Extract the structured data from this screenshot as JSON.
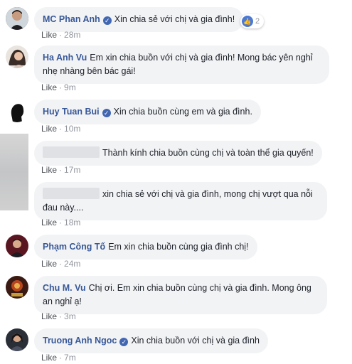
{
  "comments": [
    {
      "author": "MC Phan Anh",
      "verified": true,
      "text": "Xin chia sẻ với chị và gia đình!",
      "like": "Like",
      "time": "28m",
      "reactions": "2"
    },
    {
      "author": "Ha Anh Vu",
      "verified": false,
      "text": "Em xin chia buồn với chị và gia đình! Mong bác yên nghỉ nhẹ nhàng bên bác gái!",
      "like": "Like",
      "time": "9m"
    },
    {
      "author": "Huy Tuan Bui",
      "verified": true,
      "text": "Xin chia buồn cùng em và gia đình.",
      "like": "Like",
      "time": "10m"
    },
    {
      "author": "",
      "verified": false,
      "text": "Thành kính chia buồn cùng chị và toàn thể gia quyến!",
      "like": "Like",
      "time": "17m"
    },
    {
      "author": "",
      "verified": false,
      "text": "xin chia sẻ với chị và gia đình, mong chị vượt qua nỗi đau này....",
      "like": "Like",
      "time": "18m"
    },
    {
      "author": "Phạm Công Tố",
      "verified": false,
      "text": "Em xin chia buồn cùng gia đình chị!",
      "like": "Like",
      "time": "24m"
    },
    {
      "author": "Chu M. Vu",
      "verified": false,
      "text": "Chị ơi. Em xin chia buồn cùng chị và gia đình. Mong ông an nghỉ ạ!",
      "like": "Like",
      "time": "3m"
    },
    {
      "author": "Truong Anh Ngoc",
      "verified": true,
      "text": "Xin chia buồn với chị và gia đình",
      "like": "Like",
      "time": "7m"
    }
  ],
  "colors": {
    "author": "#385898",
    "bubble": "#f2f3f5",
    "meta": "#90949c",
    "verified": "#4267b2"
  },
  "icons": {
    "verified": "check-badge-icon",
    "reaction": "thumbs-up-icon"
  }
}
